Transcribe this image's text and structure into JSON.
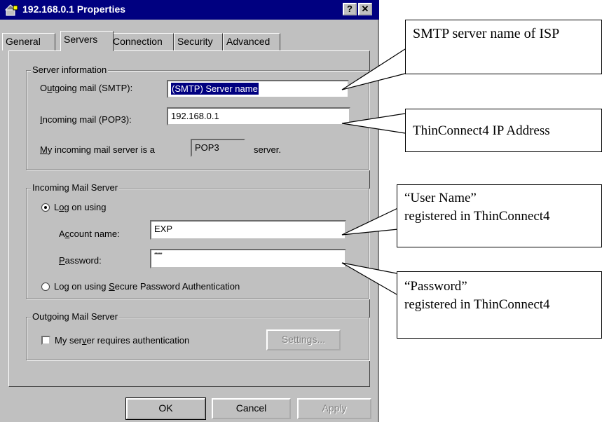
{
  "window": {
    "title": "192.168.0.1 Properties",
    "help_label": "?",
    "close_label": "✕"
  },
  "tabs": [
    {
      "label": "General"
    },
    {
      "label": "Servers"
    },
    {
      "label": "Connection"
    },
    {
      "label": "Security"
    },
    {
      "label": "Advanced"
    }
  ],
  "server_info": {
    "group_title": "Server information",
    "outgoing_label_pre": "O",
    "outgoing_label_u": "u",
    "outgoing_label_post": "tgoing mail (SMTP):",
    "outgoing_value": "(SMTP) Server name",
    "incoming_label_u": "I",
    "incoming_label_post": "ncoming mail (POP3):",
    "incoming_value": "192.168.0.1",
    "type_label_u": "M",
    "type_label_post": "y incoming mail server is a",
    "type_value": "POP3",
    "type_suffix": "server."
  },
  "incoming_server": {
    "group_title": "Incoming Mail Server",
    "logon_label_pre": "L",
    "logon_label_u": "o",
    "logon_label_post": "g on using",
    "account_label_pre": "A",
    "account_label_u": "c",
    "account_label_post": "count name:",
    "account_value": "EXP",
    "password_label_u": "P",
    "password_label_post": "assword:",
    "password_value": "*****",
    "spa_label_pre": "Log on using ",
    "spa_label_u": "S",
    "spa_label_post": "ecure Password Authentication"
  },
  "outgoing_server": {
    "group_title": "Outgoing Mail Server",
    "auth_label_pre": "My ser",
    "auth_label_u": "v",
    "auth_label_post": "er requires authentication",
    "settings_label": "Settings..."
  },
  "buttons": {
    "ok": "OK",
    "cancel": "Cancel",
    "apply": "Apply"
  },
  "callouts": {
    "smtp": "SMTP server name of ISP",
    "ip": "ThinConnect4 IP Address",
    "user_line1": "“User Name”",
    "user_line2": "registered in ThinConnect4",
    "pass_line1": "“Password”",
    "pass_line2": "registered in ThinConnect4"
  }
}
